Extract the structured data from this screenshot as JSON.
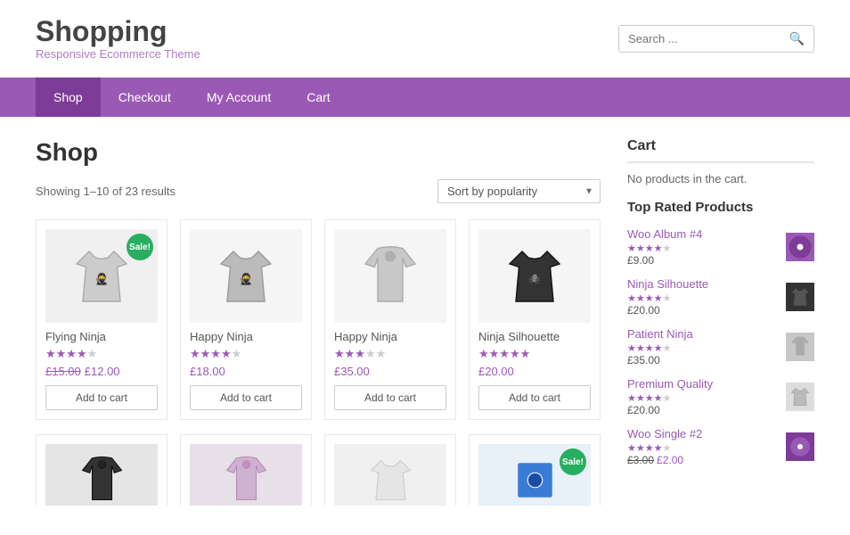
{
  "header": {
    "title": "Shopping",
    "subtitle": "Responsive Ecommerce Theme",
    "search_placeholder": "Search ..."
  },
  "nav": {
    "items": [
      {
        "label": "Shop",
        "active": true
      },
      {
        "label": "Checkout",
        "active": false
      },
      {
        "label": "My Account",
        "active": false
      },
      {
        "label": "Cart",
        "active": false
      }
    ]
  },
  "page": {
    "title": "Shop",
    "showing": "Showing 1–10 of 23 results",
    "sort_label": "Sort by popularity"
  },
  "products": [
    {
      "name": "Flying Ninja",
      "stars": 4,
      "max_stars": 5,
      "price": "£12.00",
      "old_price": "£15.00",
      "on_sale": true,
      "has_old_price": true,
      "button": "Add to cart",
      "color": "#e8e8e8"
    },
    {
      "name": "Happy Ninja",
      "stars": 4,
      "max_stars": 5,
      "price": "£18.00",
      "old_price": "",
      "on_sale": false,
      "has_old_price": false,
      "button": "Add to cart",
      "color": "#d5d5d5"
    },
    {
      "name": "Happy Ninja",
      "stars": 3,
      "max_stars": 5,
      "price": "£35.00",
      "old_price": "",
      "on_sale": false,
      "has_old_price": false,
      "button": "Add to cart",
      "color": "#c8c8c8"
    },
    {
      "name": "Ninja Silhouette",
      "stars": 5,
      "max_stars": 5,
      "price": "£20.00",
      "old_price": "",
      "on_sale": false,
      "has_old_price": false,
      "button": "Add to cart",
      "color": "#555"
    }
  ],
  "cart": {
    "title": "Cart",
    "empty_text": "No products in the cart."
  },
  "top_rated": {
    "title": "Top Rated Products",
    "items": [
      {
        "name": "Woo Album #4",
        "stars": 4,
        "price": "£9.00",
        "old_price": "",
        "has_old": false
      },
      {
        "name": "Ninja Silhouette",
        "stars": 4,
        "price": "£20.00",
        "old_price": "",
        "has_old": false
      },
      {
        "name": "Patient Ninja",
        "stars": 4,
        "price": "£35.00",
        "old_price": "",
        "has_old": false
      },
      {
        "name": "Premium Quality",
        "stars": 4,
        "price": "£20.00",
        "old_price": "",
        "has_old": false
      },
      {
        "name": "Woo Single #2",
        "stars": 4,
        "price": "£2.00",
        "old_price": "£3.00",
        "has_old": true
      }
    ]
  }
}
